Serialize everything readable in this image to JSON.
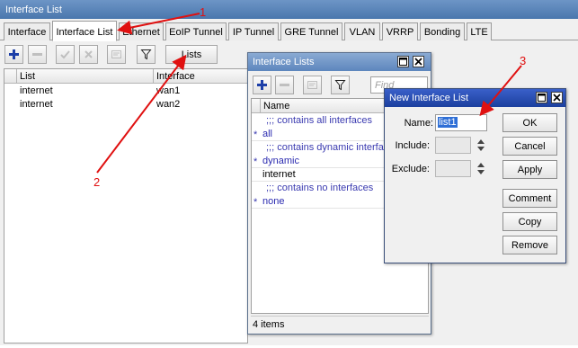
{
  "window": {
    "title": "Interface List"
  },
  "tabs": [
    {
      "label": "Interface",
      "active": false
    },
    {
      "label": "Interface List",
      "active": true
    },
    {
      "label": "Ethernet",
      "active": false
    },
    {
      "label": "EoIP Tunnel",
      "active": false
    },
    {
      "label": "IP Tunnel",
      "active": false
    },
    {
      "label": "GRE Tunnel",
      "active": false
    },
    {
      "label": "VLAN",
      "active": false
    },
    {
      "label": "VRRP",
      "active": false
    },
    {
      "label": "Bonding",
      "active": false
    },
    {
      "label": "LTE",
      "active": false
    }
  ],
  "toolbar": {
    "lists_label": "Lists",
    "icons": [
      "plus-icon",
      "minus-icon",
      "check-icon",
      "cross-icon",
      "comment-icon",
      "filter-icon"
    ]
  },
  "main_table": {
    "columns": [
      "List",
      "Interface"
    ],
    "rows": [
      {
        "list": "internet",
        "interface": "wan1"
      },
      {
        "list": "internet",
        "interface": "wan2"
      }
    ]
  },
  "lists_dialog": {
    "title": "Interface Lists",
    "find_placeholder": "Find",
    "column": "Name",
    "rows": [
      {
        "text": ";;; contains all interfaces",
        "kind": "comment"
      },
      {
        "text": "all",
        "kind": "builtin",
        "star": "*"
      },
      {
        "text": ";;; contains dynamic interfaces",
        "kind": "comment"
      },
      {
        "text": "dynamic",
        "kind": "builtin",
        "star": "*"
      },
      {
        "text": "internet",
        "kind": "user"
      },
      {
        "text": ";;; contains no interfaces",
        "kind": "comment"
      },
      {
        "text": "none",
        "kind": "builtin",
        "star": "*"
      }
    ],
    "status": "4 items"
  },
  "new_dialog": {
    "title": "New Interface List",
    "name_label": "Name:",
    "name_value": "list1",
    "include_label": "Include:",
    "exclude_label": "Exclude:",
    "buttons": {
      "ok": "OK",
      "cancel": "Cancel",
      "apply": "Apply",
      "comment": "Comment",
      "copy": "Copy",
      "remove": "Remove"
    }
  },
  "annotations": {
    "color": "#e01010",
    "labels": [
      "1",
      "2",
      "3"
    ]
  },
  "colors": {
    "accent_blue": "#1b3f9e",
    "comment_blue": "#3a3ab0"
  }
}
